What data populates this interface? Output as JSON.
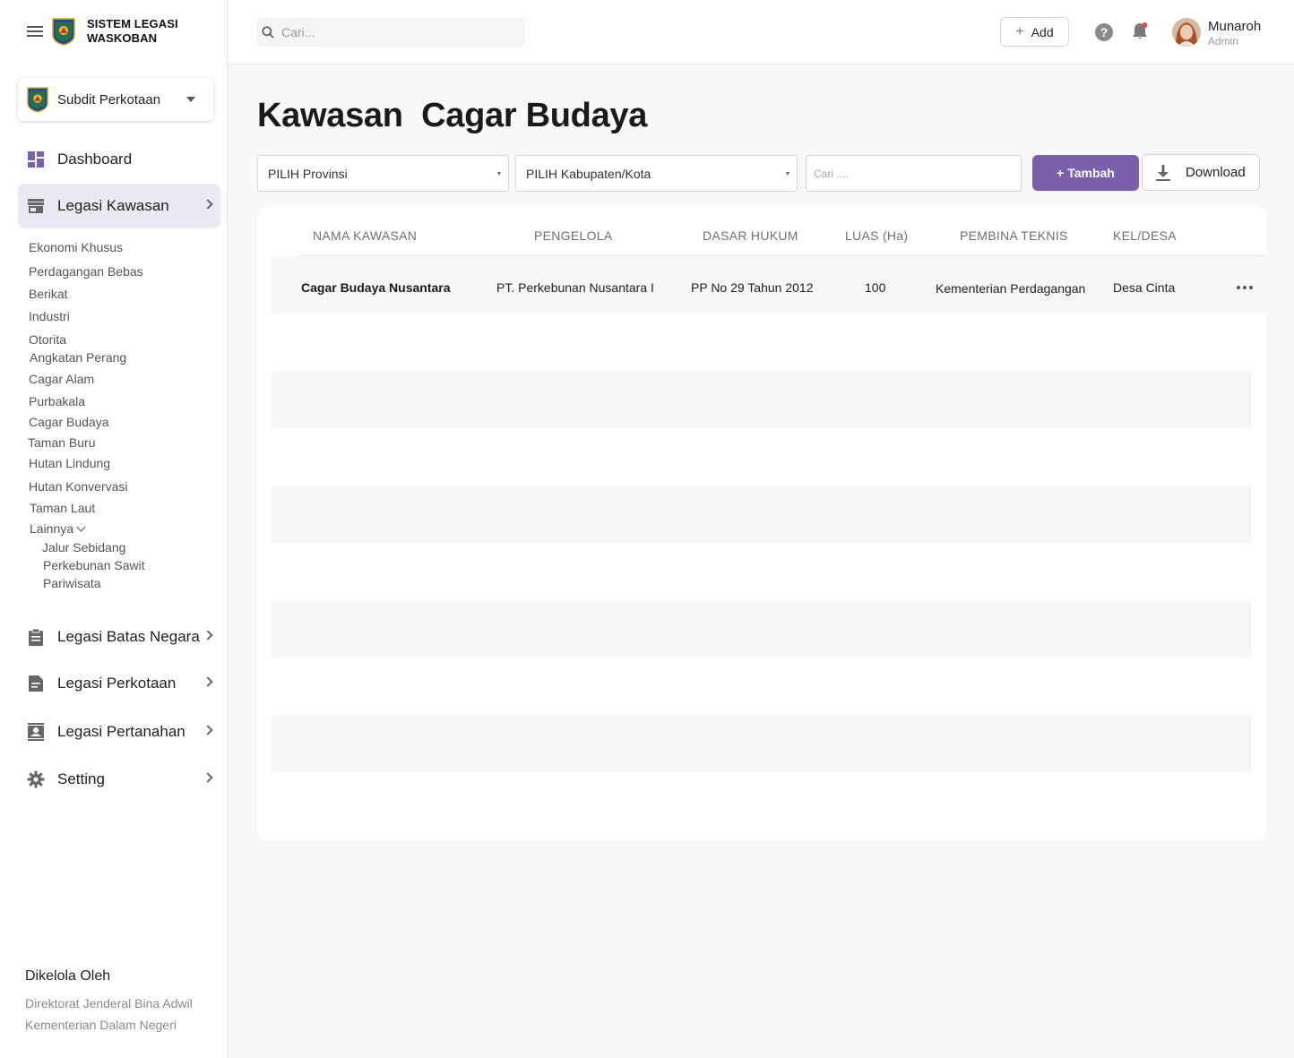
{
  "app": {
    "title_line1": "SISTEM LEGASI",
    "title_line2": "WASKOBAN"
  },
  "department": {
    "selected": "Subdit Perkotaan"
  },
  "sidebar": {
    "nav": [
      {
        "label": "Dashboard",
        "icon": "dashboard-icon"
      },
      {
        "label": "Legasi Kawasan",
        "icon": "store-icon"
      },
      {
        "label": "Legasi Batas Negara",
        "icon": "clipboard-icon"
      },
      {
        "label": "Legasi Perkotaan",
        "icon": "document-icon"
      },
      {
        "label": "Legasi Pertanahan",
        "icon": "contact-card-icon"
      },
      {
        "label": "Setting",
        "icon": "gear-icon"
      }
    ],
    "kawasan_items": [
      "Ekonomi Khusus",
      "Perdagangan Bebas",
      "Berikat",
      "Industri",
      "Otorita",
      "Angkatan Perang",
      "Cagar Alam",
      "Purbakala",
      "Cagar Budaya",
      "Taman Buru",
      "Hutan Lindung",
      "Hutan Konvervasi",
      "Taman Laut",
      "Lainnya"
    ],
    "lainnya_items": [
      "Jalur Sebidang",
      "Perkebunan Sawit",
      "Pariwisata"
    ],
    "managed_title": "Dikelola Oleh",
    "managed_line1": "Direktorat Jenderal Bina Adwil",
    "managed_line2": "Kementerian Dalam Negeri"
  },
  "topbar": {
    "search_placeholder": "Cari...",
    "add_label": "Add",
    "help_symbol": "?",
    "user_name": "Munaroh",
    "user_role": "Admin"
  },
  "main": {
    "title": "Kawasan  Cagar Budaya",
    "province_select": "PILIH Provinsi",
    "city_select": "PILIH Kabupaten/Kota",
    "search_placeholder": "Cari ....",
    "add_button": "+ Tambah",
    "download_button": "Download"
  },
  "table": {
    "headers": [
      "NAMA KAWASAN",
      "PENGELOLA",
      "DASAR HUKUM",
      "LUAS (Ha)",
      "PEMBINA TEKNIS",
      "KEL/DESA"
    ],
    "rows": [
      {
        "nama": "Cagar Budaya Nusantara",
        "pengelola": "PT. Perkebunan Nusantara I",
        "dasar_hukum": "PP No 29 Tahun 2012",
        "luas": "100",
        "pembina": "Kementerian Perdagangan",
        "desa": "Desa Cinta"
      }
    ]
  },
  "colors": {
    "accent": "#7a5fab",
    "active_nav_bg": "#ece9f2",
    "notification_dot": "#e5484d"
  }
}
